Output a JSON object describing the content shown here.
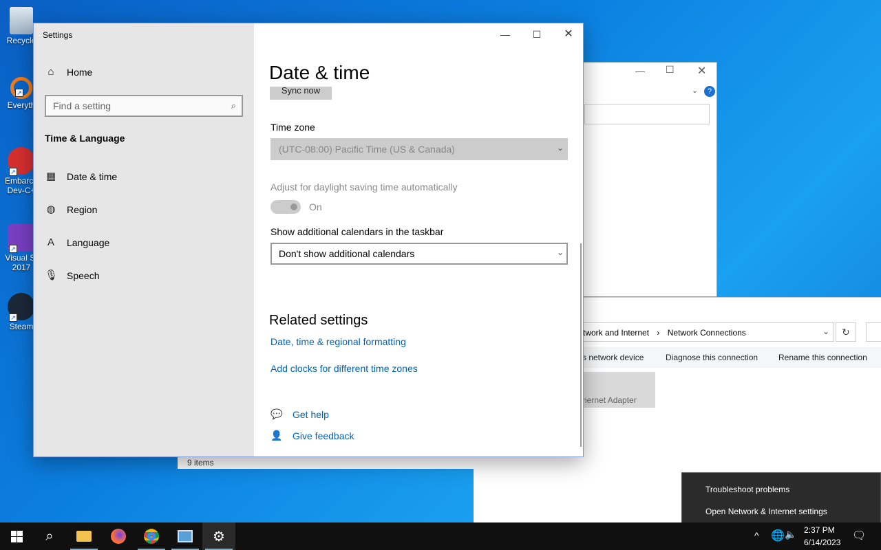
{
  "desktop": {
    "icons": [
      {
        "label": "Recycle"
      },
      {
        "label": "Everyth"
      },
      {
        "label": "Embarca Dev-C+"
      },
      {
        "label": "Visual St 2017"
      },
      {
        "label": "Steam"
      }
    ]
  },
  "background": {
    "explorer_breadcrumb_1": "twork and Internet",
    "explorer_breadcrumb_sep": "›",
    "explorer_breadcrumb_2": "Network Connections",
    "cmd_1": "s network device",
    "cmd_2": "Diagnose this connection",
    "cmd_3": "Rename this connection",
    "adapter_label": "hernet Adapter",
    "status_items": "9 items"
  },
  "settings": {
    "window_title": "Settings",
    "nav": {
      "home": "Home",
      "search_placeholder": "Find a setting",
      "section": "Time & Language",
      "items": [
        {
          "label": "Date & time",
          "icon": "calendar-clock-icon"
        },
        {
          "label": "Region",
          "icon": "globe-icon"
        },
        {
          "label": "Language",
          "icon": "language-icon"
        },
        {
          "label": "Speech",
          "icon": "microphone-icon"
        }
      ]
    },
    "page": {
      "title": "Date & time",
      "sync_now": "Sync now",
      "time_zone_label": "Time zone",
      "time_zone_value": "(UTC-08:00) Pacific Time (US & Canada)",
      "dst_label": "Adjust for daylight saving time automatically",
      "dst_state": "On",
      "calendars_label": "Show additional calendars in the taskbar",
      "calendars_value": "Don't show additional calendars",
      "related_title": "Related settings",
      "link_formatting": "Date, time & regional formatting",
      "link_clocks": "Add clocks for different time zones",
      "get_help": "Get help",
      "give_feedback": "Give feedback"
    }
  },
  "context_menu": {
    "items": [
      "Troubleshoot problems",
      "Open Network & Internet settings"
    ]
  },
  "taskbar": {
    "time": "2:37 PM",
    "date": "6/14/2023"
  }
}
